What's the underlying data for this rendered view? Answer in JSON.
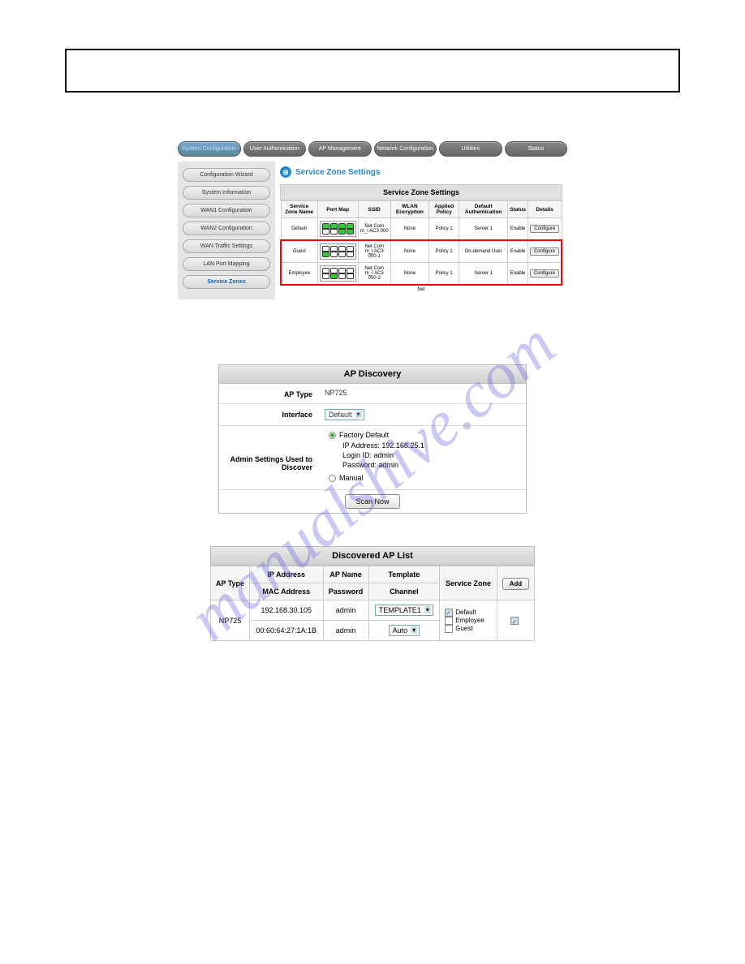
{
  "nav": {
    "system": "System Configuration",
    "user": "User Authentication",
    "ap": "AP Management",
    "network": "Network Configuration",
    "utilities": "Utilities",
    "status": "Status"
  },
  "sidebar": {
    "wizard": "Configuration Wizard",
    "sysinfo": "System Information",
    "wan1": "WAN1 Configuration",
    "wan2": "WAN2 Configuration",
    "traffic": "WAN Traffic Settings",
    "lanport": "LAN Port Mapping",
    "zones": "Service Zones"
  },
  "zone": {
    "section_title": "Service Zone Settings",
    "table_title": "Service Zone Settings",
    "cols": {
      "name": "Service Zone Name",
      "portmap": "Port Map",
      "ssid": "SSID",
      "wlan": "WLAN Encryption",
      "policy": "Applied Policy",
      "auth": "Default Authentication",
      "status": "Status",
      "details": "Details"
    },
    "rows": [
      {
        "name": "Default",
        "ssid": "Net Com m_I AC3 000",
        "wlan": "None",
        "policy": "Policy 1",
        "auth": "Server 1",
        "status": "Enable",
        "btn": "Configure"
      },
      {
        "name": "Guest",
        "ssid": "Net Com m_I AC3 000-1",
        "wlan": "None",
        "policy": "Policy 1",
        "auth": "On-demand User",
        "status": "Enable",
        "btn": "Configure"
      },
      {
        "name": "Employee",
        "ssid": "Net Com m_I AC3 000-2",
        "wlan": "None",
        "policy": "Policy 1",
        "auth": "Server 1",
        "status": "Enable",
        "btn": "Configure"
      }
    ],
    "footer": "Net"
  },
  "discovery": {
    "title": "AP Discovery",
    "aptype_label": "AP Type",
    "aptype_value": "NP725",
    "interface_label": "Interface",
    "interface_value": "Default",
    "admin_label": "Admin Settings Used to Discover",
    "factory": "Factory Default",
    "ip_label": "IP Address:",
    "ip_value": "192.168.25.1",
    "login_label": "Login ID:",
    "login_value": "admin",
    "password_label": "Password:",
    "password_value": "admin",
    "manual": "Manual",
    "scan": "Scan Now"
  },
  "discovered": {
    "title": "Discovered AP List",
    "cols": {
      "aptype": "AP Type",
      "ip": "IP Address",
      "mac": "MAC Address",
      "apname": "AP Name",
      "password": "Password",
      "template": "Template",
      "channel": "Channel",
      "sz": "Service Zone",
      "add": "Add"
    },
    "row": {
      "aptype": "NP725",
      "ip": "192.168.30.105",
      "mac": "00:60:64:27:1A:1B",
      "apname": "admin",
      "password": "admin",
      "template": "TEMPLATE1",
      "channel": "Auto",
      "sz_default": "Default",
      "sz_employee": "Employee",
      "sz_guest": "Guest"
    }
  }
}
